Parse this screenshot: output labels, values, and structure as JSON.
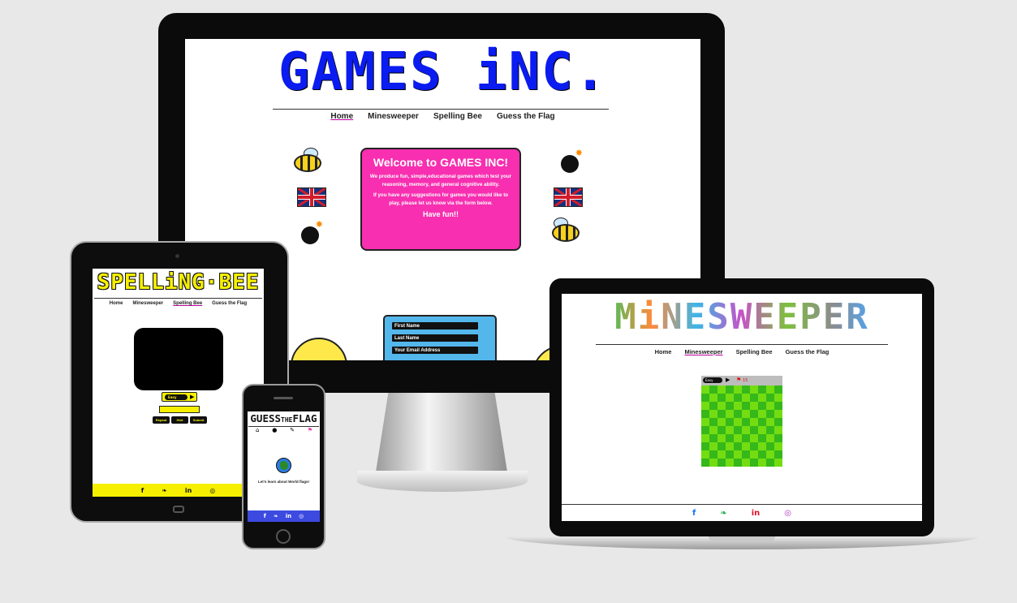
{
  "monitor": {
    "logo": "GAMES iNC.",
    "nav": [
      "Home",
      "Minesweeper",
      "Spelling Bee",
      "Guess the Flag"
    ],
    "welcome": {
      "title": "Welcome to GAMES INC!",
      "p1": "We produce fun, simple,educational games which test your reasoning, memory, and general cognitive ability.",
      "p2": "If you have any suggestions for games you would like to play, please let us know via the form below.",
      "fun": "Have fun!!"
    },
    "form": {
      "first_name": "First Name",
      "last_name": "Last Name",
      "email": "Your Email Address"
    }
  },
  "tablet": {
    "logo": "SPELLiNG·BEE",
    "nav": [
      "Home",
      "Minesweeper",
      "Spelling Bee",
      "Guess the Flag"
    ],
    "difficulty": "Easy",
    "buttons": [
      "Repeat",
      "Hint",
      "Submit"
    ],
    "social": [
      "f",
      "❧",
      "in",
      "◎"
    ]
  },
  "laptop": {
    "logo": "MiNESWEEPER",
    "nav": [
      "Home",
      "Minesweeper",
      "Spelling Bee",
      "Guess the Flag"
    ],
    "difficulty": "Easy",
    "flag_count": "15",
    "social": [
      "f",
      "❧",
      "in",
      "◎"
    ],
    "social_colors": [
      "#1877f2",
      "#1da84a",
      "#e0102a",
      "#b03cb8"
    ]
  },
  "phone": {
    "logo_left": "GUESS",
    "logo_mid": "THE",
    "logo_right": "FLAG",
    "tagline": "Let's learn about World flags!",
    "social": [
      "f",
      "❧",
      "in",
      "◎"
    ]
  }
}
